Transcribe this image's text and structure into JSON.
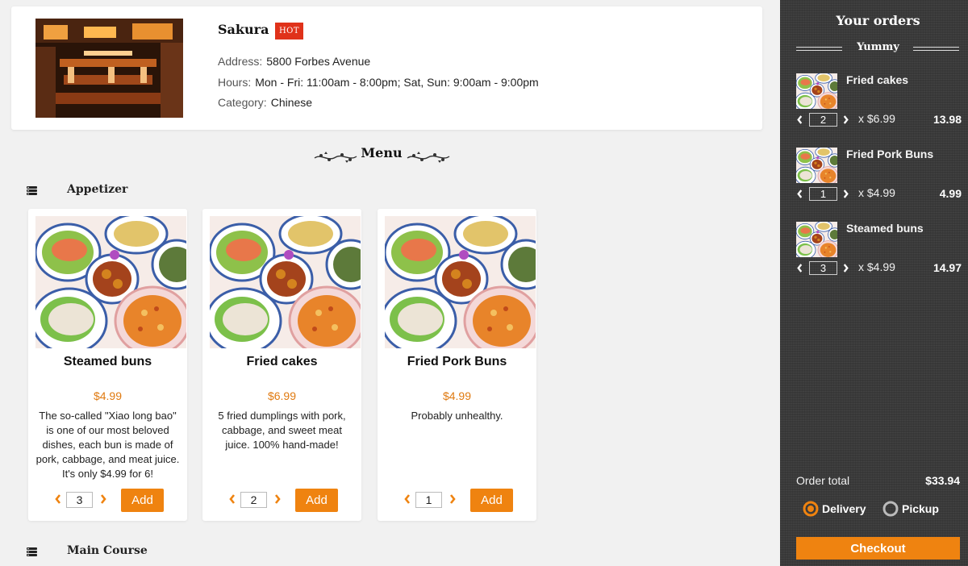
{
  "restaurant": {
    "name": "Sakura",
    "badge": "HOT",
    "address_label": "Address:",
    "address": "5800 Forbes Avenue",
    "hours_label": "Hours:",
    "hours": "Mon - Fri: 11:00am - 8:00pm; Sat, Sun: 9:00am - 9:00pm",
    "category_label": "Category:",
    "category": "Chinese"
  },
  "menu": {
    "title": "Menu",
    "sections": [
      {
        "title": "Appetizer",
        "items": [
          {
            "name": "Steamed buns",
            "price": "$4.99",
            "description": "The so-called \"Xiao long bao\" is one of our most beloved dishes, each bun is made of pork, cabbage, and meat juice. It's only $4.99 for 6!",
            "quantity": "3",
            "add_label": "Add"
          },
          {
            "name": "Fried cakes",
            "price": "$6.99",
            "description": "5 fried dumplings with pork, cabbage, and sweet meat juice. 100% hand-made!",
            "quantity": "2",
            "add_label": "Add"
          },
          {
            "name": "Fried Pork Buns",
            "price": "$4.99",
            "description": "Probably unhealthy.",
            "quantity": "1",
            "add_label": "Add"
          }
        ]
      },
      {
        "title": "Main Course",
        "items": []
      }
    ]
  },
  "orders": {
    "title": "Your orders",
    "subtitle": "Yummy",
    "items": [
      {
        "name": "Fried cakes",
        "quantity": "2",
        "unit_price": "x $6.99",
        "line_total": "13.98"
      },
      {
        "name": "Fried Pork Buns",
        "quantity": "1",
        "unit_price": "x $4.99",
        "line_total": "4.99"
      },
      {
        "name": "Steamed buns",
        "quantity": "3",
        "unit_price": "x $4.99",
        "line_total": "14.97"
      }
    ],
    "total_label": "Order total",
    "total_value": "$33.94",
    "delivery_label": "Delivery",
    "pickup_label": "Pickup",
    "selected_method": "Delivery",
    "checkout_label": "Checkout"
  },
  "colors": {
    "accent": "#ef8310",
    "badge": "#e0321a",
    "price": "#e07a10",
    "sidebar": "#3a3a3a"
  },
  "icons": [
    "menu-stack-icon",
    "chevron-left-icon",
    "chevron-right-icon",
    "flourish-left-icon",
    "flourish-right-icon",
    "radio-selected-icon",
    "radio-unselected-icon"
  ]
}
